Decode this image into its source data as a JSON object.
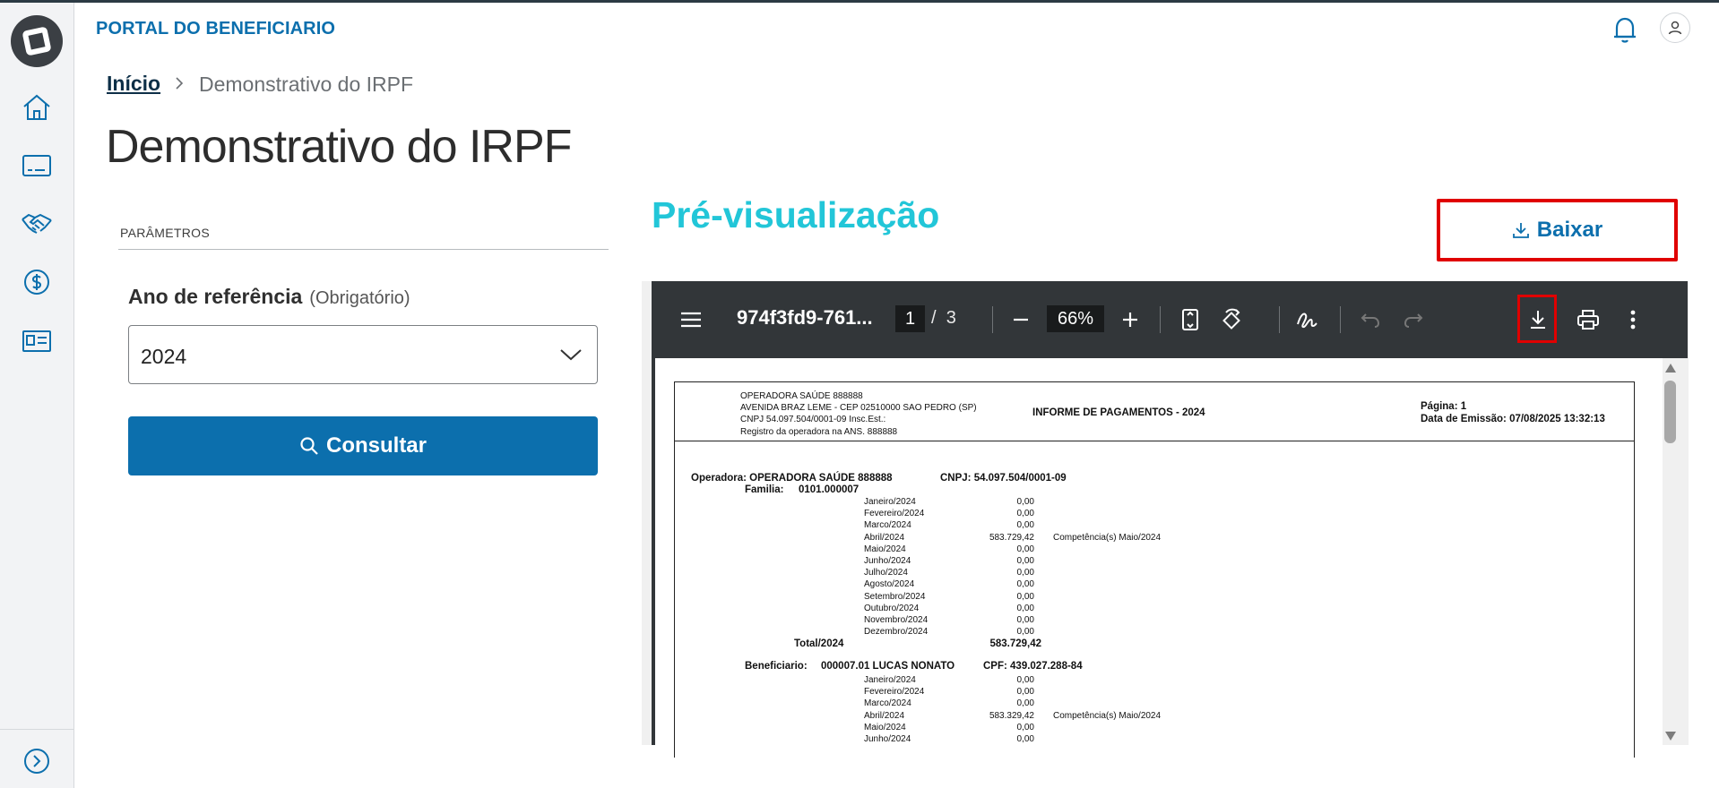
{
  "header": {
    "portal_title": "PORTAL DO BENEFICIARIO"
  },
  "sidebar": {
    "items": [
      {
        "icon": "home-icon"
      },
      {
        "icon": "card-icon"
      },
      {
        "icon": "handshake-icon"
      },
      {
        "icon": "dollar-icon"
      },
      {
        "icon": "receipt-icon"
      }
    ],
    "expand_icon": "chevron-right-circle-icon"
  },
  "breadcrumb": {
    "home": "Início",
    "current": "Demonstrativo do IRPF"
  },
  "page_title": "Demonstrativo do IRPF",
  "params": {
    "section_label": "PARÂMETROS",
    "field_label": "Ano de referência",
    "field_optional": "(Obrigatório)",
    "selected_year": "2024",
    "submit_label": "Consultar"
  },
  "preview": {
    "title": "Pré-visualização",
    "download_label": "Baixar"
  },
  "pdf_toolbar": {
    "file_name": "974f3fd9-761...",
    "current_page": "1",
    "page_sep": "/",
    "total_pages": "3",
    "zoom": "66%"
  },
  "pdf_doc": {
    "company": "OPERADORA SAÚDE 888888",
    "address": "AVENIDA BRAZ LEME - CEP 02510000 SAO PEDRO (SP)",
    "cnpj_line": "CNPJ 54.097.504/0001-09  Insc.Est.:",
    "ans_line": "Registro da operadora na ANS. 888888",
    "report_title": "INFORME DE PAGAMENTOS  - 2024",
    "page_label": "Página: 1",
    "emission": "Data de Emissão: 07/08/2025 13:32:13",
    "operadora_line": "Operadora: OPERADORA SAÚDE 888888",
    "operadora_cnpj": "CNPJ: 54.097.504/0001-09",
    "familia_label": "Familia:",
    "familia_value": "0101.000007",
    "family_months": [
      {
        "month": "Janeiro/2024",
        "value": "0,00",
        "note": ""
      },
      {
        "month": "Fevereiro/2024",
        "value": "0,00",
        "note": ""
      },
      {
        "month": "Marco/2024",
        "value": "0,00",
        "note": ""
      },
      {
        "month": "Abril/2024",
        "value": "583.729,42",
        "note": "Competência(s) Maio/2024"
      },
      {
        "month": "Maio/2024",
        "value": "0,00",
        "note": ""
      },
      {
        "month": "Junho/2024",
        "value": "0,00",
        "note": ""
      },
      {
        "month": "Julho/2024",
        "value": "0,00",
        "note": ""
      },
      {
        "month": "Agosto/2024",
        "value": "0,00",
        "note": ""
      },
      {
        "month": "Setembro/2024",
        "value": "0,00",
        "note": ""
      },
      {
        "month": "Outubro/2024",
        "value": "0,00",
        "note": ""
      },
      {
        "month": "Novembro/2024",
        "value": "0,00",
        "note": ""
      },
      {
        "month": "Dezembro/2024",
        "value": "0,00",
        "note": ""
      }
    ],
    "total_label": "Total/2024",
    "total_value": "583.729,42",
    "beneficiario_label": "Beneficiario:",
    "beneficiario_value": "000007.01 LUCAS NONATO",
    "beneficiario_cpf": "CPF: 439.027.288-84",
    "beneficiario_months": [
      {
        "month": "Janeiro/2024",
        "value": "0,00",
        "note": ""
      },
      {
        "month": "Fevereiro/2024",
        "value": "0,00",
        "note": ""
      },
      {
        "month": "Marco/2024",
        "value": "0,00",
        "note": ""
      },
      {
        "month": "Abril/2024",
        "value": "583.329,42",
        "note": "Competência(s) Maio/2024"
      },
      {
        "month": "Maio/2024",
        "value": "0,00",
        "note": ""
      },
      {
        "month": "Junho/2024",
        "value": "0,00",
        "note": ""
      }
    ]
  },
  "colors": {
    "brand": "#0c6fad",
    "preview_title": "#22c6d8",
    "highlight": "#e00000",
    "toolbar": "#323639"
  }
}
